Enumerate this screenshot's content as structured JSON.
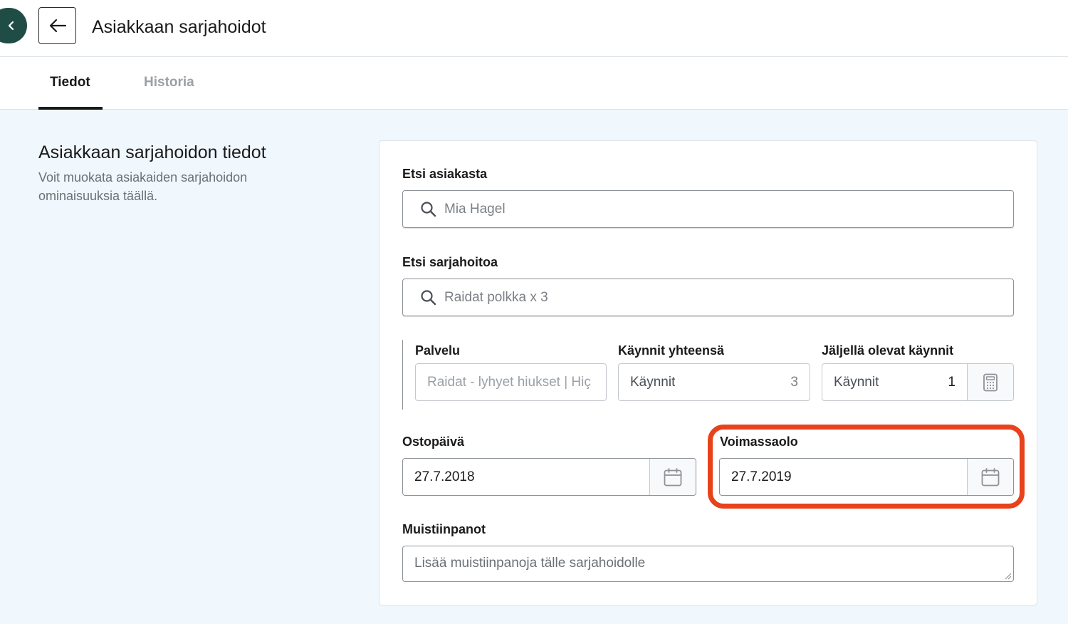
{
  "header": {
    "title": "Asiakkaan sarjahoidot"
  },
  "tabs": [
    {
      "label": "Tiedot",
      "active": true
    },
    {
      "label": "Historia",
      "active": false
    }
  ],
  "section": {
    "title": "Asiakkaan sarjahoidon tiedot",
    "description": "Voit muokata asiakaiden sarjahoidon ominaisuuksia täällä."
  },
  "form": {
    "customer": {
      "label": "Etsi asiakasta",
      "value": "Mia Hagel"
    },
    "series": {
      "label": "Etsi sarjahoitoa",
      "value": "Raidat polkka x 3"
    },
    "service": {
      "label": "Palvelu",
      "value": "Raidat - lyhyet hiukset | Hiç"
    },
    "total_visits": {
      "label": "Käynnit yhteensä",
      "placeholder": "Käynnit",
      "value": "3"
    },
    "remaining_visits": {
      "label": "Jäljellä olevat käynnit",
      "placeholder": "Käynnit",
      "value": "1"
    },
    "purchase_date": {
      "label": "Ostopäivä",
      "value": "27.7.2018"
    },
    "valid_until": {
      "label": "Voimassaolo",
      "value": "27.7.2019"
    },
    "notes": {
      "label": "Muistiinpanot",
      "placeholder": "Lisää muistiinpanoja tälle sarjahoidolle"
    }
  },
  "colors": {
    "highlight": "#e8421c",
    "sidebar": "#1f4d46",
    "background": "#f0f7fd"
  }
}
